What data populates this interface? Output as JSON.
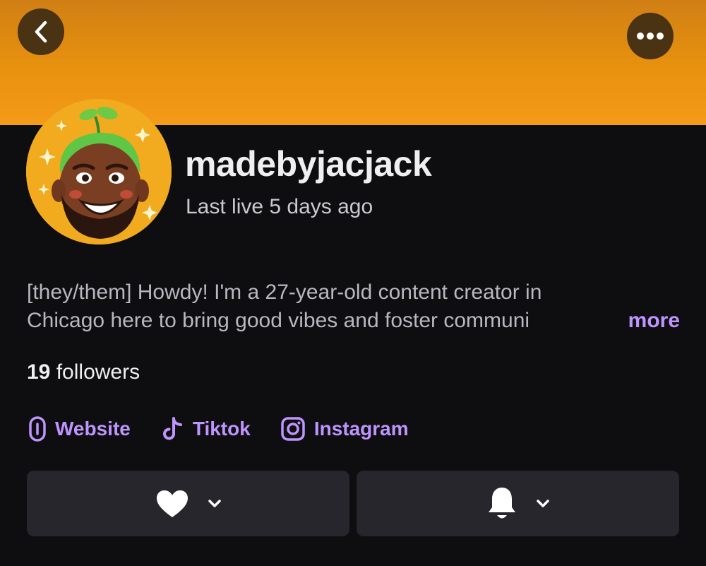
{
  "header": {
    "back_icon": "chevron-left-icon",
    "more_icon": "ellipsis-icon",
    "banner_color": "#e8920f"
  },
  "profile": {
    "username": "madebyjacjack",
    "last_live": "Last live 5 days ago",
    "bio_line1": "[they/them] Howdy! I'm a 27-year-old content creator in",
    "bio_line2": "Chicago here to bring good vibes and foster communi",
    "more_label": "more",
    "followers_count": "19",
    "followers_label": "followers"
  },
  "links": [
    {
      "label": "Website",
      "icon": "link-icon"
    },
    {
      "label": "Tiktok",
      "icon": "tiktok-icon"
    },
    {
      "label": "Instagram",
      "icon": "instagram-icon"
    }
  ],
  "actions": {
    "follow_icon": "heart-icon",
    "notify_icon": "bell-icon",
    "dropdown_icon": "chevron-down-icon"
  },
  "colors": {
    "accent": "#bf94ff",
    "background": "#0e0e10",
    "button_bg": "#26262c"
  }
}
